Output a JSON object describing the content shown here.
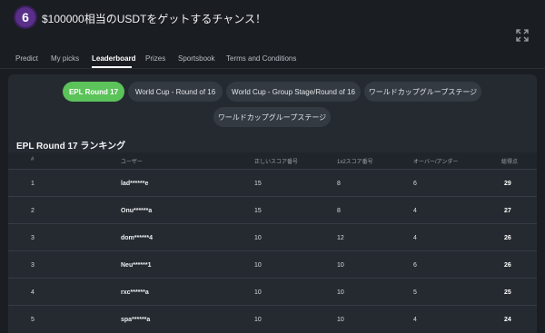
{
  "header": {
    "logo_text": "6",
    "title": "$100000相当のUSDTをゲットするチャンス！"
  },
  "tabs": [
    {
      "label": "Predict"
    },
    {
      "label": "My picks"
    },
    {
      "label": "Leaderboard"
    },
    {
      "label": "Prizes"
    },
    {
      "label": "Sportsbook"
    },
    {
      "label": "Terms and Conditions"
    }
  ],
  "filters": [
    {
      "label": "EPL Round 17",
      "active": true
    },
    {
      "label": "World Cup - Round of 16"
    },
    {
      "label": "World Cup - Group Stage/Round of 16"
    },
    {
      "label": "ワールドカップグループステージ"
    },
    {
      "label": "ワールドカップグループステージ"
    }
  ],
  "leaderboard": {
    "title": "EPL Round 17 ランキング",
    "columns": [
      "#",
      "ユーザー",
      "正しいスコア番号",
      "1x2スコア番号",
      "オーバー/アンダー",
      "総得点"
    ],
    "rows": [
      {
        "rank": "1",
        "user": "lad******e",
        "correct": "15",
        "x12": "8",
        "ou": "6",
        "total": "29"
      },
      {
        "rank": "2",
        "user": "Onu******a",
        "correct": "15",
        "x12": "8",
        "ou": "4",
        "total": "27"
      },
      {
        "rank": "3",
        "user": "dom******4",
        "correct": "10",
        "x12": "12",
        "ou": "4",
        "total": "26"
      },
      {
        "rank": "3",
        "user": "Neu******1",
        "correct": "10",
        "x12": "10",
        "ou": "6",
        "total": "26"
      },
      {
        "rank": "4",
        "user": "rxc******a",
        "correct": "10",
        "x12": "10",
        "ou": "5",
        "total": "25"
      },
      {
        "rank": "5",
        "user": "spa******a",
        "correct": "10",
        "x12": "10",
        "ou": "4",
        "total": "24"
      }
    ]
  },
  "colors": {
    "background": "#1a1d22",
    "panel": "#252a30",
    "accent": "#5cc35a",
    "logo": "#5a2f8a"
  }
}
